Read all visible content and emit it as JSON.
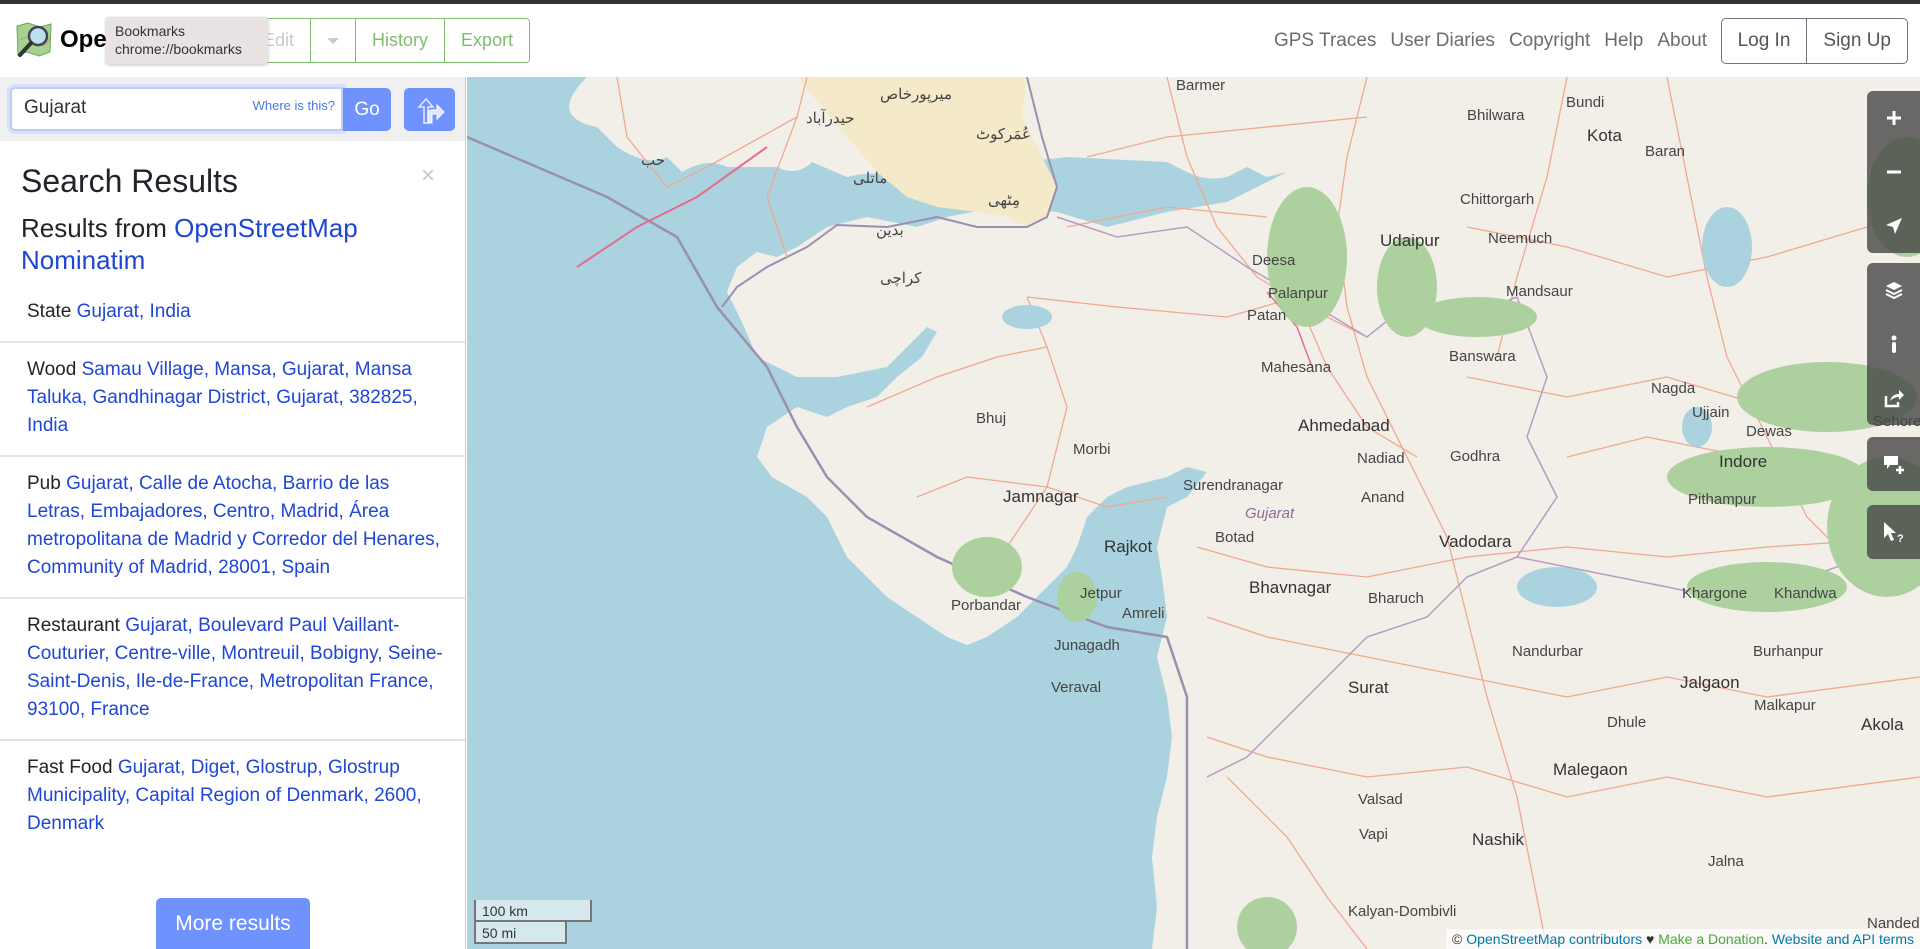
{
  "header": {
    "logo_text": "Ope",
    "tooltip_title": "Bookmarks",
    "tooltip_url": "chrome://bookmarks",
    "edit_label": "Edit",
    "history_label": "History",
    "export_label": "Export",
    "nav": [
      "GPS Traces",
      "User Diaries",
      "Copyright",
      "Help",
      "About"
    ],
    "login_label": "Log In",
    "signup_label": "Sign Up"
  },
  "search": {
    "value": "Gujarat",
    "where_label": "Where is this?",
    "go_label": "Go"
  },
  "results": {
    "title": "Search Results",
    "source_prefix": "Results from",
    "source_link": "OpenStreetMap Nominatim",
    "close_label": "×",
    "items": [
      {
        "type": "State",
        "name": "Gujarat, India"
      },
      {
        "type": "Wood",
        "name": "Samau Village, Mansa, Gujarat, Mansa Taluka, Gandhinagar District, Gujarat, 382825, India"
      },
      {
        "type": "Pub",
        "name": "Gujarat, Calle de Atocha, Barrio de las Letras, Embajadores, Centro, Madrid, Área metropolitana de Madrid y Corredor del Henares, Community of Madrid, 28001, Spain"
      },
      {
        "type": "Restaurant",
        "name": "Gujarat, Boulevard Paul Vaillant-Couturier, Centre-ville, Montreuil, Bobigny, Seine-Saint-Denis, Ile-de-France, Metropolitan France, 93100, France"
      },
      {
        "type": "Fast Food",
        "name": "Gujarat, Diget, Glostrup, Glostrup Municipality, Capital Region of Denmark, 2600, Denmark"
      }
    ],
    "more_label": "More results"
  },
  "map": {
    "labels": {
      "karachi": "كراچى",
      "hub": "حب",
      "hyderabad": "حيدرآباد",
      "mirpurkhas": "ميرپورخاص",
      "umerkot": "عُمَركوٹ",
      "matli": "ماتلى",
      "badin": "بدين",
      "mithi": "مِٹھی",
      "barmer": "Barmer",
      "bhilwara": "Bhilwara",
      "bundi": "Bundi",
      "kota": "Kota",
      "baran": "Baran",
      "chittorgarh": "Chittorgarh",
      "udaipur": "Udaipur",
      "neemuch": "Neemuch",
      "mandsaur": "Mandsaur",
      "deesa": "Deesa",
      "palanpur": "Palanpur",
      "patan": "Patan",
      "mahesana": "Mahesana",
      "banswara": "Banswara",
      "nagda": "Nagda",
      "ujjain": "Ujjain",
      "dewas": "Dewas",
      "indore": "Indore",
      "pithampur": "Pithampur",
      "sehore": "Sehore",
      "bhuj": "Bhuj",
      "ahmedabad": "Ahmedabad",
      "godhra": "Godhra",
      "nadiad": "Nadiad",
      "anand": "Anand",
      "vadodara": "Vadodara",
      "morbi": "Morbi",
      "surendranagar": "Surendranagar",
      "gujarat": "Gujarat",
      "jamnagar": "Jamnagar",
      "rajkot": "Rajkot",
      "botad": "Botad",
      "bhavnagar": "Bhavnagar",
      "bharuch": "Bharuch",
      "porbandar": "Porbandar",
      "jetpur": "Jetpur",
      "amreli": "Amreli",
      "junagadh": "Junagadh",
      "veraval": "Veraval",
      "khargone": "Khargone",
      "khandwa": "Khandwa",
      "nandurbar": "Nandurbar",
      "burhanpur": "Burhanpur",
      "surat": "Surat",
      "jalgaon": "Jalgaon",
      "malkapur": "Malkapur",
      "akola": "Akola",
      "dhule": "Dhule",
      "valsad": "Valsad",
      "vapi": "Vapi",
      "malegaon": "Malegaon",
      "nashik": "Nashik",
      "jalna": "Jalna",
      "kalyan": "Kalyan-Dombivli",
      "nanded": "Nanded-"
    },
    "scale_km": "100 km",
    "scale_mi": "50 mi",
    "attribution": {
      "copyright": "©",
      "osm_link": "OpenStreetMap contributors",
      "heart": "♥",
      "donate_link": "Make a Donation",
      "separator": ".",
      "terms_link": "Website and API terms"
    }
  }
}
